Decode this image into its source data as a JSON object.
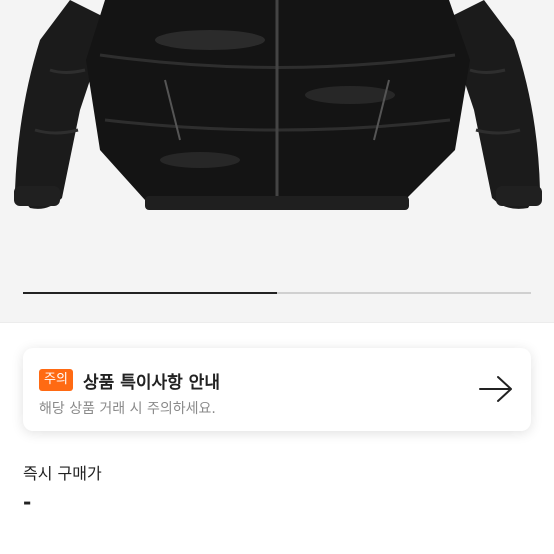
{
  "carousel": {
    "image_alt": "black puffer jacket",
    "progress": 0.5
  },
  "notice": {
    "badge": "주의",
    "title": "상품 특이사항 안내",
    "subtitle": "해당 상품 거래 시 주의하세요.",
    "icon": "arrow-right-icon"
  },
  "price": {
    "label": "즉시 구매가",
    "value": "-"
  },
  "colors": {
    "accent": "#ff6a13",
    "text": "#222222",
    "muted": "#8a8a8a"
  }
}
